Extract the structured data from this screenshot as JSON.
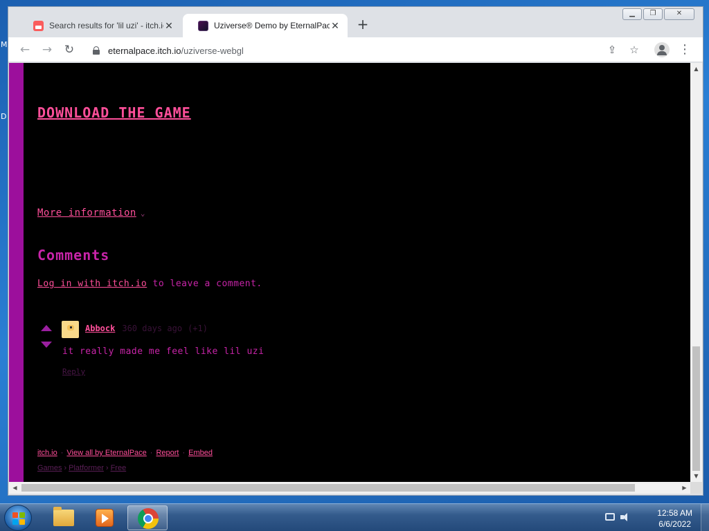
{
  "desktop": {
    "edge_labels": [
      "M",
      "D"
    ]
  },
  "browser": {
    "tabs": [
      {
        "title": "Search results for 'lil uzi' - itch.io",
        "close": "✕",
        "active": false
      },
      {
        "title": "Uziverse® Demo by EternalPace",
        "close": "✕",
        "active": true
      }
    ],
    "new_tab": "+",
    "window_controls": {
      "minimize": "▁",
      "maximize": "❐",
      "close": "✕"
    },
    "nav": {
      "back": "←",
      "forward": "→",
      "reload": "↻"
    },
    "url": {
      "host": "eternalpace.itch.io",
      "path": "/uziverse-webgl"
    },
    "toolbar_icons": {
      "share": "⇪",
      "bookmark": "☆",
      "menu": "⋮"
    }
  },
  "page": {
    "download_label": "DOWNLOAD THE GAME",
    "more_information_label": "More information",
    "more_information_chevron": "⌄",
    "comments_heading": "Comments",
    "login_link": "Log in with itch.io",
    "login_rest": " to leave a comment.",
    "comment": {
      "author": "Abbock",
      "time": "360 days ago",
      "votes": "(+1)",
      "body": "it really made me feel like lil uzi",
      "reply": "Reply"
    },
    "footer_links": [
      "itch.io",
      "View all by EternalPace",
      "Report",
      "Embed"
    ],
    "footer_sep": "·",
    "breadcrumbs": [
      "Games",
      "Platformer",
      "Free"
    ],
    "breadcrumb_sep": "›"
  },
  "colors": {
    "accent_pink": "#ff4f9a",
    "accent_purple": "#c724a8",
    "sidebar_purple": "#9c0f9c",
    "page_bg": "#000000"
  },
  "taskbar": {
    "items": [
      "folder-icon",
      "media-player-icon",
      "chrome-icon"
    ],
    "active_item": "chrome-icon",
    "clock": {
      "time": "12:58 AM",
      "date": "6/6/2022"
    }
  }
}
